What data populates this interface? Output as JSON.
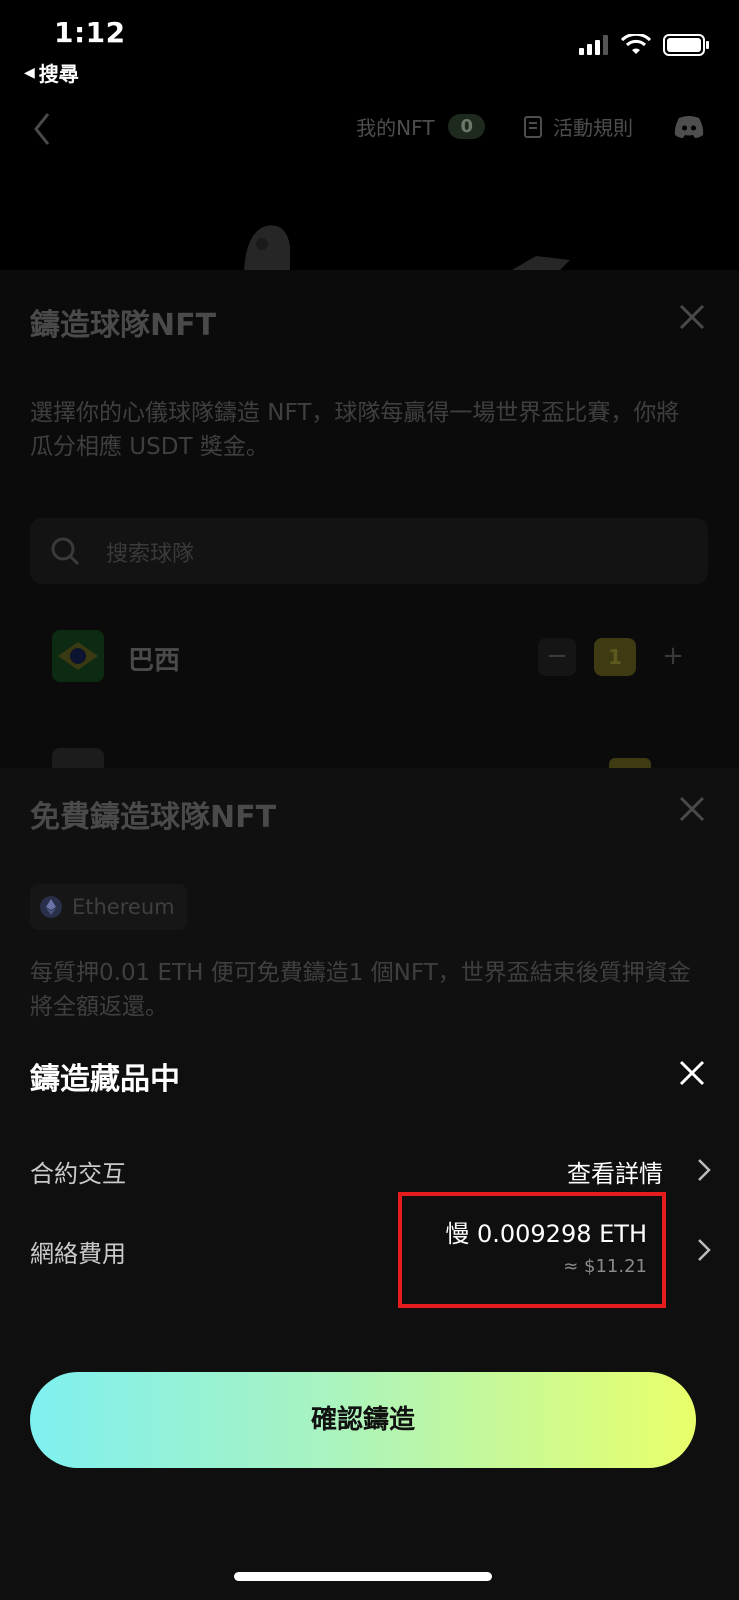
{
  "status_bar": {
    "time": "1:12",
    "back_app": "搜尋"
  },
  "nav": {
    "my_nft_label": "我的NFT",
    "my_nft_count": "0",
    "rules_label": "活動規則"
  },
  "sheet_teams": {
    "title": "鑄造球隊NFT",
    "description": "選擇你的心儀球隊鑄造 NFT，球隊每贏得一場世界盃比賽，你將瓜分相應 USDT 獎金。",
    "search_placeholder": "搜索球隊",
    "teams": [
      {
        "name": "巴西",
        "quantity": "1",
        "minus": "−",
        "plus": "+"
      }
    ]
  },
  "sheet_free_mint": {
    "title": "免費鑄造球隊NFT",
    "network": "Ethereum",
    "description": "每質押0.01 ETH 便可免費鑄造1 個NFT，世界盃結束後質押資金將全額返還。"
  },
  "sheet_minting": {
    "title": "鑄造藏品中",
    "contract_label": "合約交互",
    "contract_value": "查看詳情",
    "fee_label": "網絡費用",
    "fee_value": "慢 0.009298 ETH",
    "fee_usd": "≈ $11.21",
    "confirm_label": "確認鑄造"
  },
  "colors": {
    "highlight_border": "#e61b1b",
    "button_gradient_start": "#7ff0f0",
    "button_gradient_end": "#e9ff6a"
  }
}
